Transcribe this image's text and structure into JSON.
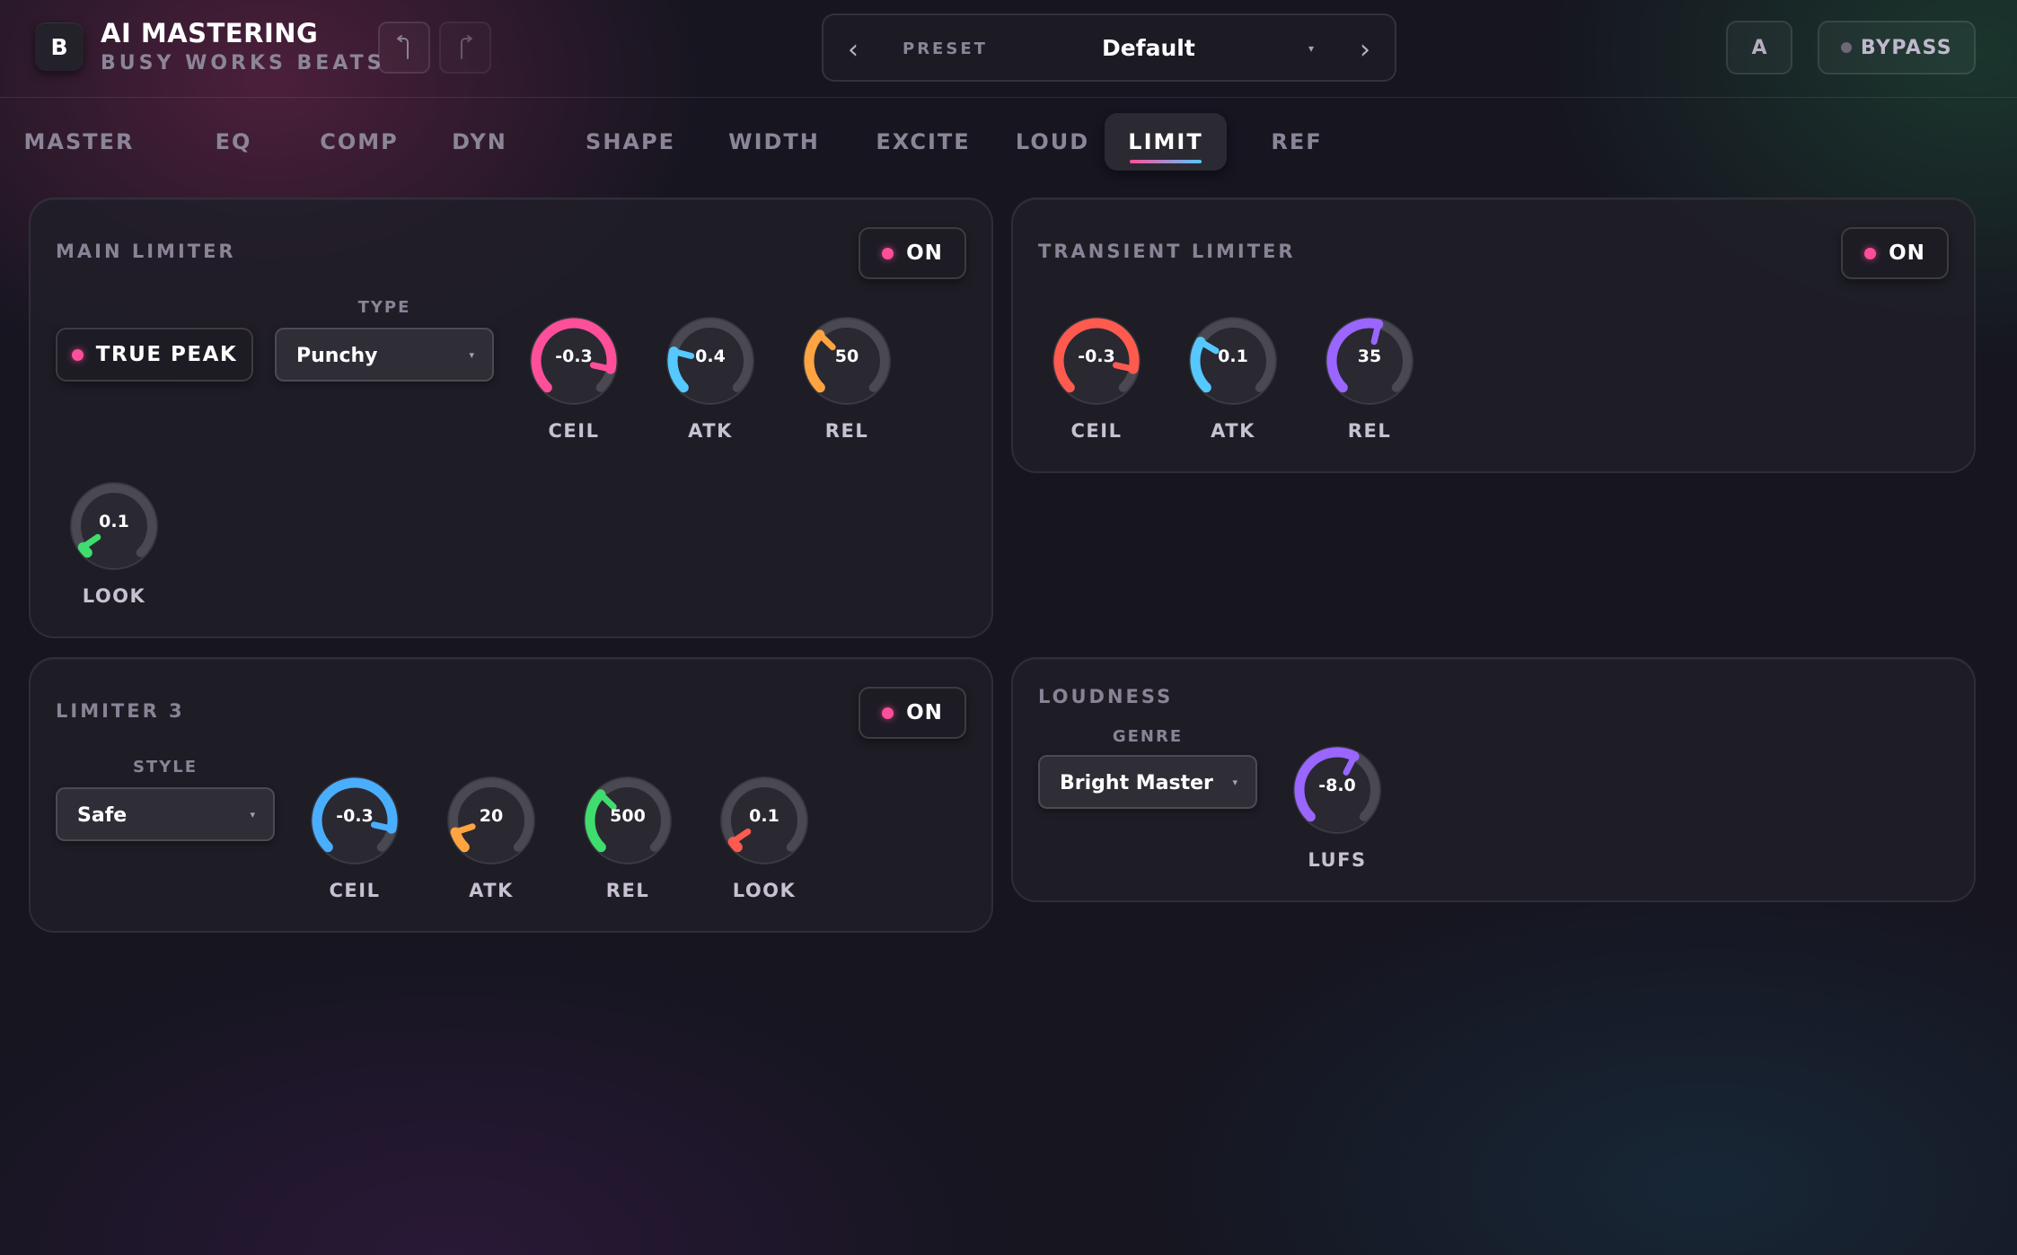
{
  "app": {
    "logo_letter": "B",
    "title": "AI MASTERING",
    "subtitle": "BUSY WORKS BEATS"
  },
  "history": {
    "undo_icon": "undo-icon",
    "redo_icon": "redo-icon"
  },
  "preset": {
    "label": "PRESET",
    "value": "Default",
    "prev_icon": "chevron-left-icon",
    "next_icon": "chevron-right-icon",
    "caret_icon": "caret-down-icon"
  },
  "compare": {
    "label": "A"
  },
  "bypass": {
    "label": "BYPASS",
    "active": false
  },
  "tabs": [
    {
      "label": "MASTER",
      "active": false
    },
    {
      "label": "EQ",
      "active": false
    },
    {
      "label": "COMP",
      "active": false
    },
    {
      "label": "DYN",
      "active": false
    },
    {
      "label": "SHAPE",
      "active": false
    },
    {
      "label": "WIDTH",
      "active": false
    },
    {
      "label": "EXCITE",
      "active": false
    },
    {
      "label": "LOUD",
      "active": false
    },
    {
      "label": "LIMIT",
      "active": true
    },
    {
      "label": "REF",
      "active": false
    }
  ],
  "colors": {
    "pink": "#ff4f9a",
    "blue": "#55c8ff",
    "orange": "#ffa440",
    "red": "#ff5a4e",
    "purple": "#9a66ff",
    "green": "#3fdc6e",
    "sky": "#4aaeff"
  },
  "main_limiter": {
    "title": "MAIN LIMITER",
    "on_label": "ON",
    "true_peak_label": "TRUE PEAK",
    "type_label": "TYPE",
    "type_value": "Punchy",
    "knobs": [
      {
        "value": "-0.3",
        "label": "CEIL",
        "level": 0.88,
        "color": "#ff4f9a"
      },
      {
        "value": "0.4",
        "label": "ATK",
        "level": 0.22,
        "color": "#55c8ff"
      },
      {
        "value": "50",
        "label": "REL",
        "level": 0.33,
        "color": "#ffa440"
      },
      {
        "value": "0.1",
        "label": "LOOK",
        "level": 0.04,
        "color": "#3fdc6e"
      }
    ]
  },
  "transient_limiter": {
    "title": "TRANSIENT LIMITER",
    "on_label": "ON",
    "knobs": [
      {
        "value": "-0.3",
        "label": "CEIL",
        "level": 0.88,
        "color": "#ff5a4e"
      },
      {
        "value": "0.1",
        "label": "ATK",
        "level": 0.28,
        "color": "#55c8ff"
      },
      {
        "value": "35",
        "label": "REL",
        "level": 0.55,
        "color": "#9a66ff"
      }
    ]
  },
  "limiter3": {
    "title": "LIMITER 3",
    "on_label": "ON",
    "style_label": "STYLE",
    "style_value": "Safe",
    "knobs": [
      {
        "value": "-0.3",
        "label": "CEIL",
        "level": 0.88,
        "color": "#4aaeff"
      },
      {
        "value": "20",
        "label": "ATK",
        "level": 0.1,
        "color": "#ffa440"
      },
      {
        "value": "500",
        "label": "REL",
        "level": 0.33,
        "color": "#3fdc6e"
      },
      {
        "value": "0.1",
        "label": "LOOK",
        "level": 0.04,
        "color": "#ff5a4e"
      }
    ]
  },
  "loudness": {
    "title": "LOUDNESS",
    "genre_label": "GENRE",
    "genre_value": "Bright Master",
    "knobs": [
      {
        "value": "-8.0",
        "label": "LUFS",
        "level": 0.6,
        "color": "#9a66ff"
      }
    ]
  }
}
